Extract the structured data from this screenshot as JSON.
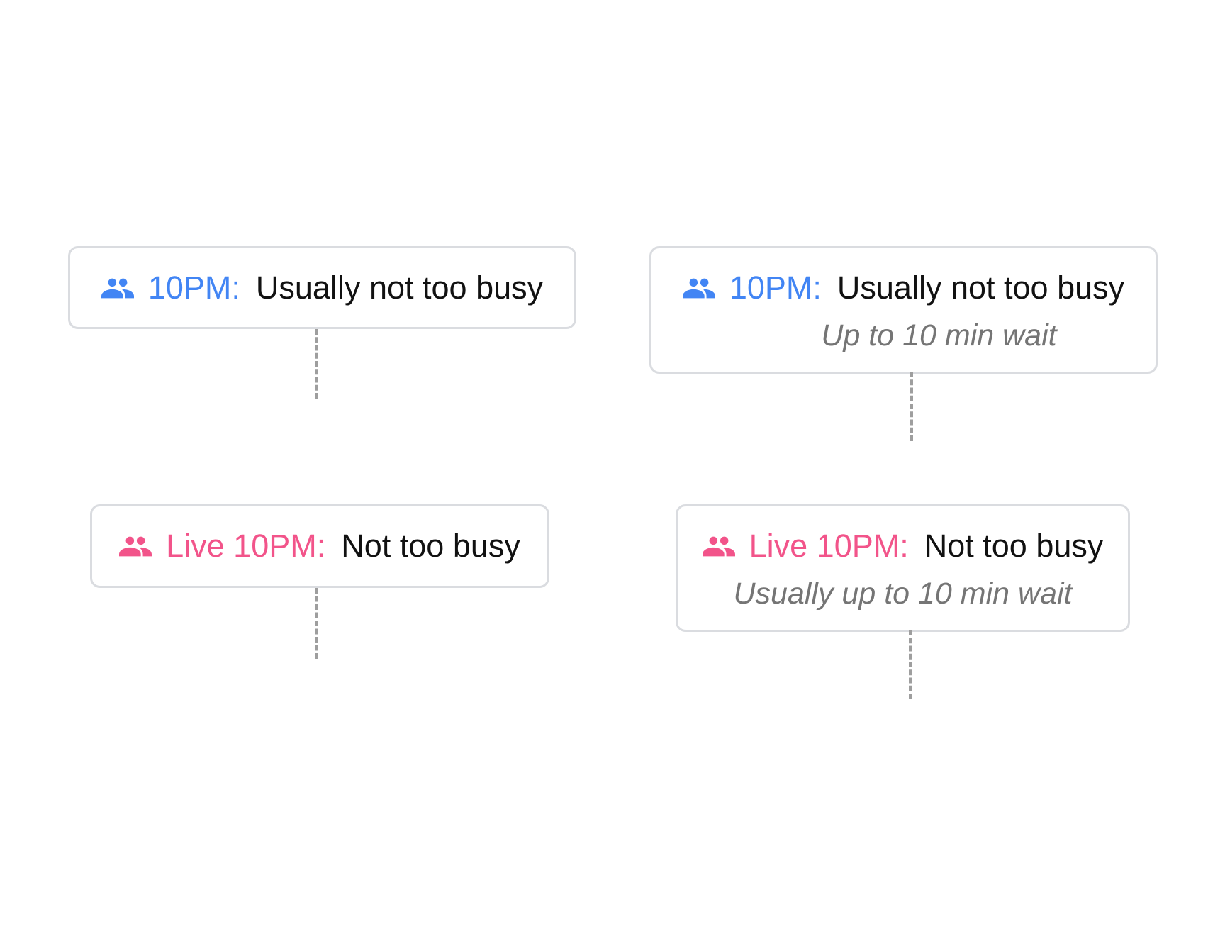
{
  "colors": {
    "usual_accent": "#4285f4",
    "live_accent": "#f2548a",
    "status_text": "#111111",
    "wait_text": "#757575",
    "card_border": "#dadce0",
    "connector": "#9e9e9e"
  },
  "cards": [
    {
      "icon": "people-icon",
      "time_label": "10PM:",
      "status": "Usually not too busy"
    },
    {
      "icon": "people-icon",
      "time_label": "10PM:",
      "status": "Usually not too busy",
      "wait": "Up to 10 min wait"
    },
    {
      "icon": "people-icon",
      "time_label": "Live 10PM:",
      "status": "Not too busy"
    },
    {
      "icon": "people-icon",
      "time_label": "Live 10PM:",
      "status": "Not too busy",
      "wait": "Usually up to 10 min wait"
    }
  ]
}
